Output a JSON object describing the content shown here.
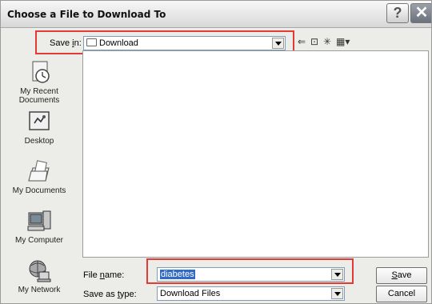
{
  "title": "Choose a File to Download To",
  "titlebar_buttons": {
    "help": "?",
    "close": "✕"
  },
  "save_in": {
    "label_pre": "Save ",
    "label_accel": "i",
    "label_post": "n:",
    "value": "Download"
  },
  "toolbar": {
    "back": "⇐",
    "up": "⊡",
    "new_folder": "✳",
    "view": "▦▾"
  },
  "places": [
    {
      "label": "My Recent\nDocuments",
      "icon": "recent-documents-icon"
    },
    {
      "label": "Desktop",
      "icon": "desktop-icon"
    },
    {
      "label": "My Documents",
      "icon": "my-documents-icon"
    },
    {
      "label": "My Computer",
      "icon": "my-computer-icon"
    },
    {
      "label": "My Network",
      "icon": "my-network-icon"
    }
  ],
  "file_name": {
    "label_pre": "File ",
    "label_accel": "n",
    "label_post": "ame:",
    "value": "diabetes"
  },
  "save_as_type": {
    "label_pre": "Save as ",
    "label_accel": "t",
    "label_post": "ype:",
    "value": "Download Files"
  },
  "buttons": {
    "save_accel": "S",
    "save_rest": "ave",
    "cancel": "Cancel"
  },
  "colors": {
    "highlight_box": "#e53935",
    "selection": "#316ac5"
  }
}
